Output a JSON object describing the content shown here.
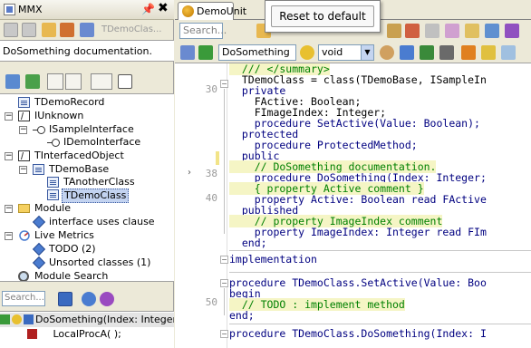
{
  "left_panel": {
    "title": "MMX",
    "pin": "📌",
    "close": "✖",
    "selected_class_label": "TDemoClas...",
    "doc_text": "DoSomething documentation.",
    "tree": [
      {
        "label": "TDemoRecord"
      },
      {
        "label": "IUnknown",
        "toggle": "−"
      },
      {
        "label": "ISampleInterface",
        "toggle": "−"
      },
      {
        "label": "IDemoInterface"
      },
      {
        "label": "TInterfacedObject",
        "toggle": "−"
      },
      {
        "label": "TDemoBase",
        "toggle": "−"
      },
      {
        "label": "TAnotherClass"
      },
      {
        "label": "TDemoClass"
      },
      {
        "label": "Module",
        "toggle": "−"
      },
      {
        "label": "interface uses clause"
      },
      {
        "label": "Live Metrics",
        "toggle": "−"
      },
      {
        "label": "TODO (2)"
      },
      {
        "label": "Unsorted classes (1)"
      },
      {
        "label": "Module Search"
      }
    ],
    "search_placeholder": "Search...",
    "members": [
      {
        "label": "DoSomething(Index: Integer; Co"
      },
      {
        "label": "LocalProcA( );"
      }
    ]
  },
  "editor": {
    "tab_label": "DemoUnit",
    "search_placeholder": "Search...",
    "popup_item": "Reset to default",
    "name_field": "DoSomething",
    "type_field": "void",
    "type_arrow": "▼",
    "current_line_marker": "›",
    "line_numbers": [
      "30",
      "38",
      "40",
      "50"
    ],
    "lines": [
      {
        "text": "  /// </summary>"
      },
      {
        "text": "  TDemoClass = class(TDemoBase, ISampleIn"
      },
      {
        "text": "  private"
      },
      {
        "text": "    FActive: Boolean;"
      },
      {
        "text": "    FImageIndex: Integer;"
      },
      {
        "text": "    procedure SetActive(Value: Boolean);"
      },
      {
        "text": "  protected"
      },
      {
        "text": "    procedure ProtectedMethod;"
      },
      {
        "text": "  public"
      },
      {
        "text": "    // DoSomething documentation."
      },
      {
        "text": "    procedure DoSomething(Index: Integer;"
      },
      {
        "text": "    { property Active comment }"
      },
      {
        "text": "    property Active: Boolean read FActive"
      },
      {
        "text": "  published"
      },
      {
        "text": "    // property ImageIndex comment"
      },
      {
        "text": "    property ImageIndex: Integer read FIm"
      },
      {
        "text": "  end;"
      },
      {
        "text": ""
      },
      {
        "text": "implementation"
      },
      {
        "text": ""
      },
      {
        "text": "procedure TDemoClass.SetActive(Value: Boo"
      },
      {
        "text": "begin"
      },
      {
        "text": "  // TODO : implement method"
      },
      {
        "text": "end;"
      },
      {
        "text": ""
      },
      {
        "text": "procedure TDemoClass.DoSomething(Index: I"
      }
    ]
  },
  "colors": {
    "keyword": "#000080",
    "comment": "#008000",
    "comment_bg": "#f5f5c5",
    "selection": "#c3d3f0"
  }
}
